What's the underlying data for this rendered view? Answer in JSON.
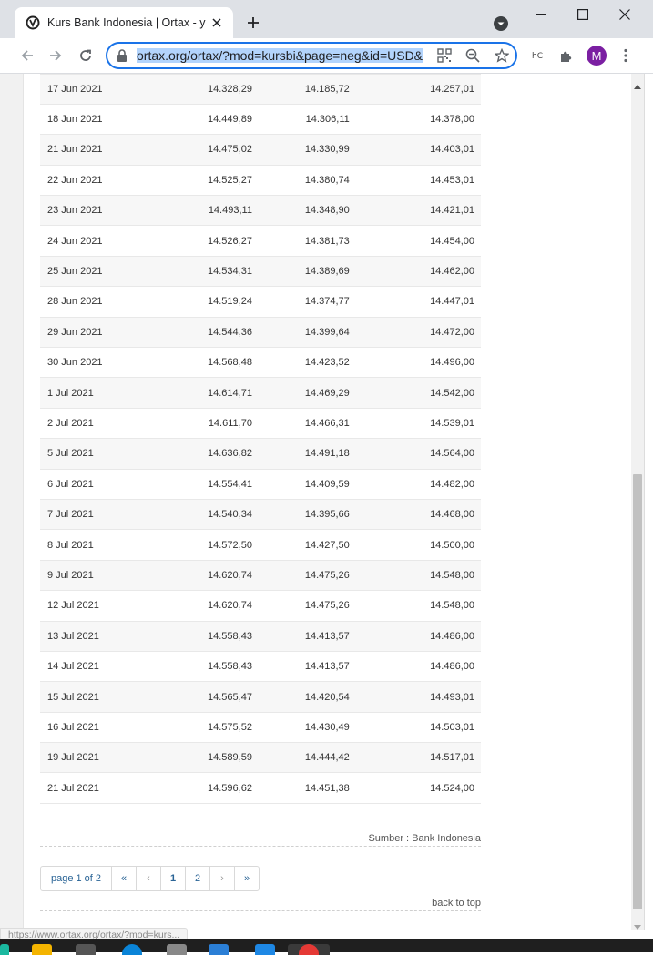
{
  "browser": {
    "tab_title": "Kurs Bank Indonesia | Ortax - you",
    "url": "ortax.org/ortax/?mod=kursbi&page=neg&id=USD&",
    "profile_initial": "M",
    "extension_label": "hC",
    "status_url": "https://www.ortax.org/ortax/?mod=kurs..."
  },
  "table": {
    "rows": [
      {
        "date": "17 Jun 2021",
        "sell": "14.328,29",
        "buy": "14.185,72",
        "mid": "14.257,01"
      },
      {
        "date": "18 Jun 2021",
        "sell": "14.449,89",
        "buy": "14.306,11",
        "mid": "14.378,00"
      },
      {
        "date": "21 Jun 2021",
        "sell": "14.475,02",
        "buy": "14.330,99",
        "mid": "14.403,01"
      },
      {
        "date": "22 Jun 2021",
        "sell": "14.525,27",
        "buy": "14.380,74",
        "mid": "14.453,01"
      },
      {
        "date": "23 Jun 2021",
        "sell": "14.493,11",
        "buy": "14.348,90",
        "mid": "14.421,01"
      },
      {
        "date": "24 Jun 2021",
        "sell": "14.526,27",
        "buy": "14.381,73",
        "mid": "14.454,00"
      },
      {
        "date": "25 Jun 2021",
        "sell": "14.534,31",
        "buy": "14.389,69",
        "mid": "14.462,00"
      },
      {
        "date": "28 Jun 2021",
        "sell": "14.519,24",
        "buy": "14.374,77",
        "mid": "14.447,01"
      },
      {
        "date": "29 Jun 2021",
        "sell": "14.544,36",
        "buy": "14.399,64",
        "mid": "14.472,00"
      },
      {
        "date": "30 Jun 2021",
        "sell": "14.568,48",
        "buy": "14.423,52",
        "mid": "14.496,00"
      },
      {
        "date": "1 Jul 2021",
        "sell": "14.614,71",
        "buy": "14.469,29",
        "mid": "14.542,00"
      },
      {
        "date": "2 Jul 2021",
        "sell": "14.611,70",
        "buy": "14.466,31",
        "mid": "14.539,01"
      },
      {
        "date": "5 Jul 2021",
        "sell": "14.636,82",
        "buy": "14.491,18",
        "mid": "14.564,00"
      },
      {
        "date": "6 Jul 2021",
        "sell": "14.554,41",
        "buy": "14.409,59",
        "mid": "14.482,00"
      },
      {
        "date": "7 Jul 2021",
        "sell": "14.540,34",
        "buy": "14.395,66",
        "mid": "14.468,00"
      },
      {
        "date": "8 Jul 2021",
        "sell": "14.572,50",
        "buy": "14.427,50",
        "mid": "14.500,00"
      },
      {
        "date": "9 Jul 2021",
        "sell": "14.620,74",
        "buy": "14.475,26",
        "mid": "14.548,00"
      },
      {
        "date": "12 Jul 2021",
        "sell": "14.620,74",
        "buy": "14.475,26",
        "mid": "14.548,00"
      },
      {
        "date": "13 Jul 2021",
        "sell": "14.558,43",
        "buy": "14.413,57",
        "mid": "14.486,00"
      },
      {
        "date": "14 Jul 2021",
        "sell": "14.558,43",
        "buy": "14.413,57",
        "mid": "14.486,00"
      },
      {
        "date": "15 Jul 2021",
        "sell": "14.565,47",
        "buy": "14.420,54",
        "mid": "14.493,01"
      },
      {
        "date": "16 Jul 2021",
        "sell": "14.575,52",
        "buy": "14.430,49",
        "mid": "14.503,01"
      },
      {
        "date": "19 Jul 2021",
        "sell": "14.589,59",
        "buy": "14.444,42",
        "mid": "14.517,01"
      },
      {
        "date": "21 Jul 2021",
        "sell": "14.596,62",
        "buy": "14.451,38",
        "mid": "14.524,00"
      }
    ]
  },
  "source_note": "Sumber : Bank Indonesia",
  "pagination": {
    "info": "page 1 of 2",
    "first": "«",
    "prev": "‹",
    "page1": "1",
    "page2": "2",
    "next": "›",
    "last": "»"
  },
  "back_to_top": "back to top",
  "colors": {
    "omnibox_focus": "#1a73e8",
    "active_page": "#c0392b",
    "link": "#2a6496",
    "avatar": "#7b1fa2"
  }
}
